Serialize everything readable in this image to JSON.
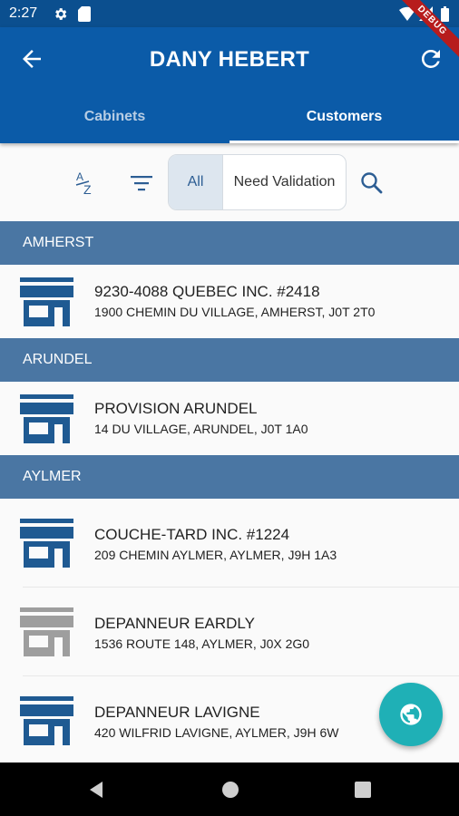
{
  "status_bar": {
    "time": "2:27",
    "icons": [
      "settings-icon",
      "sd-card-icon",
      "wifi-icon",
      "signal-icon",
      "battery-icon"
    ]
  },
  "debug_banner": "DEBUG",
  "app_bar": {
    "title": "DANY HEBERT",
    "back_icon": "arrow-back-icon",
    "refresh_icon": "refresh-icon",
    "tabs": [
      {
        "label": "Cabinets",
        "active": false
      },
      {
        "label": "Customers",
        "active": true
      }
    ]
  },
  "toolbar": {
    "sort_icon": "sort-az-icon",
    "filter_icon": "filter-icon",
    "segments": [
      {
        "label": "All",
        "selected": true
      },
      {
        "label": "Need Validation",
        "selected": false
      }
    ],
    "search_icon": "search-icon"
  },
  "sections": [
    {
      "header": "AMHERST",
      "customers": [
        {
          "name": "9230-4088 QUEBEC INC. #2418",
          "address": "1900 CHEMIN DU VILLAGE, AMHERST, J0T 2T0",
          "status_color": "#1f5a92"
        }
      ]
    },
    {
      "header": "ARUNDEL",
      "customers": [
        {
          "name": "PROVISION ARUNDEL",
          "address": "14 DU VILLAGE, ARUNDEL, J0T 1A0",
          "status_color": "#1f5a92"
        }
      ]
    },
    {
      "header": "AYLMER",
      "customers": [
        {
          "name": "COUCHE-TARD INC. #1224",
          "address": "209 CHEMIN AYLMER, AYLMER, J9H 1A3",
          "status_color": "#1f5a92"
        },
        {
          "name": "DEPANNEUR EARDLY",
          "address": "1536 ROUTE 148, AYLMER, J0X 2G0",
          "status_color": "#9e9e9e"
        },
        {
          "name": "DEPANNEUR LAVIGNE",
          "address": "420 WILFRID LAVIGNE, AYLMER, J9H 6W",
          "status_color": "#1f5a92"
        }
      ]
    }
  ],
  "fab_icon": "globe-icon",
  "colors": {
    "app_bar": "#0b5ba8",
    "status_bar": "#0b4f8f",
    "section_header": "#4a76a3",
    "fab": "#1fb0b6",
    "accent_icon": "#2c5d93"
  }
}
